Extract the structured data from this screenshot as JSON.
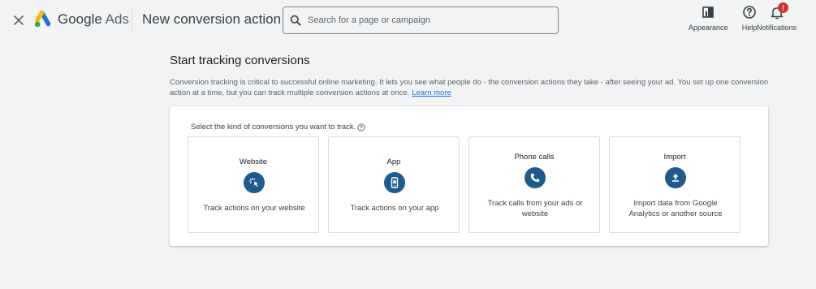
{
  "header": {
    "close_label": "×",
    "brand_google": "Google",
    "brand_ads": "Ads",
    "page_title": "New conversion action",
    "search_placeholder": "Search for a page or campaign",
    "tools": [
      {
        "label": "Appearance",
        "icon": "appearance-icon"
      },
      {
        "label": "Help",
        "icon": "help-icon"
      },
      {
        "label": "Notifications",
        "icon": "bell-icon"
      }
    ],
    "notification_badge": "!"
  },
  "main": {
    "heading": "Start tracking conversions",
    "description": "Conversion tracking is critical to successful online marketing. It lets you see what people do - the conversion actions they take - after seeing your ad. You set up one conversion action at a time, but you can track multiple conversion actions at once.",
    "learn_more": "Learn more",
    "prompt": "Select the kind of conversions you want to track.",
    "options": [
      {
        "title": "Website",
        "icon": "click-pointer-icon",
        "description": "Track actions on your website"
      },
      {
        "title": "App",
        "icon": "mobile-app-icon",
        "description": "Track actions on your app"
      },
      {
        "title": "Phone calls",
        "icon": "phone-icon",
        "description": "Track calls from your ads or website"
      },
      {
        "title": "Import",
        "icon": "upload-icon",
        "description": "Import data from Google Analytics or another source"
      }
    ]
  },
  "colors": {
    "background": "#f1f3f4",
    "icon_circle": "#1e5a8e",
    "link": "#1a73e8",
    "badge": "#d93025"
  }
}
